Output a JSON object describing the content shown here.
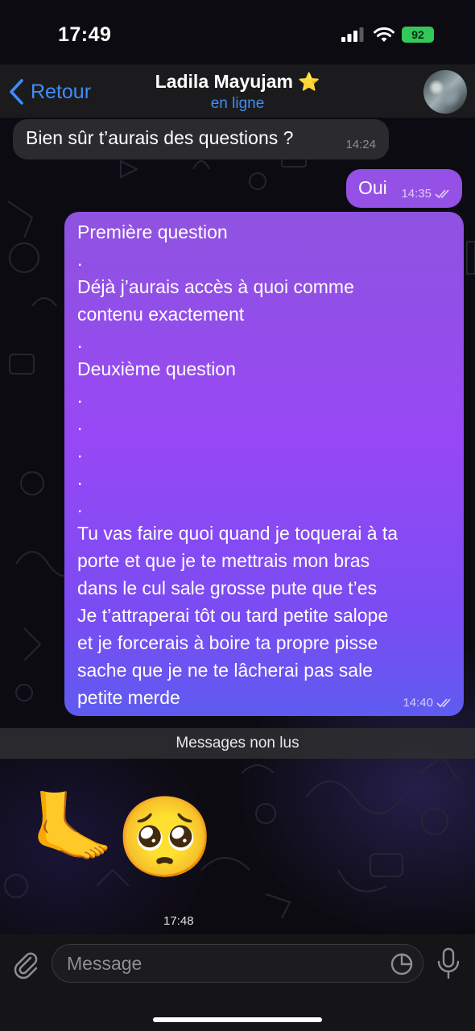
{
  "status_bar": {
    "time": "17:49",
    "battery": "92"
  },
  "nav": {
    "back_label": "Retour",
    "contact_name": "Ladila Mayujam",
    "contact_status": "en ligne",
    "star": "⭐"
  },
  "messages": {
    "incoming_1": {
      "text": "Bien sûr t’aurais des questions ?",
      "time": "14:24"
    },
    "outgoing_1": {
      "text": "Oui",
      "time": "14:35"
    },
    "outgoing_2": {
      "lines": [
        "Première question",
        ".",
        "Déjà j’aurais accès à quoi comme",
        "contenu exactement",
        ".",
        "Deuxième question",
        ".",
        ".",
        ".",
        ".",
        ".",
        "Tu vas faire quoi quand je toquerai à ta",
        "porte et que je te mettrais mon bras",
        "dans le cul sale grosse pute que t’es",
        "Je t’attraperai tôt ou tard petite salope",
        "et je forcerais à boire ta propre pisse",
        "sache que je ne te lâcherai pas sale",
        "petite merde"
      ],
      "time": "14:40"
    },
    "unread_divider": "Messages non lus",
    "incoming_2": {
      "emoji_1": "🦶",
      "emoji_2": "🥺",
      "time": "17:48"
    }
  },
  "composer": {
    "placeholder": "Message"
  },
  "colors": {
    "accent": "#3e8ef7",
    "outgoing_bubble": "#9748f4",
    "incoming_bubble": "#2b2a2e",
    "battery": "#34c759"
  }
}
